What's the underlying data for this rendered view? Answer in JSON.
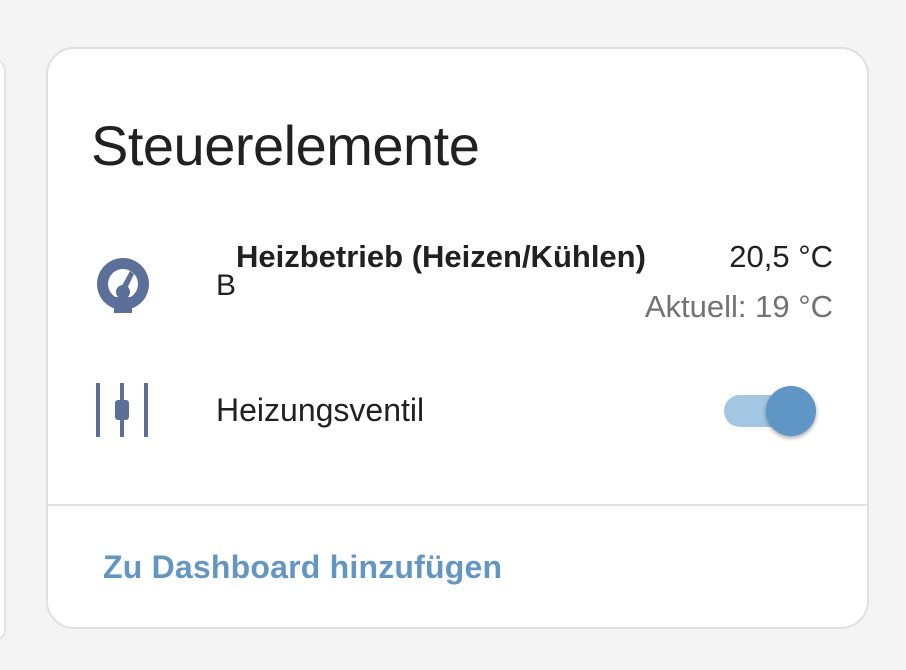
{
  "card": {
    "title": "Steuerelemente",
    "action_label": "Zu Dashboard hinzufügen"
  },
  "thermostat": {
    "icon": "thermostat-dial-icon",
    "name_prefix": "B",
    "name": "Heizbetrieb (Heizen/Kühlen)",
    "state": "20,5 °C",
    "secondary": "Aktuell: 19 °C"
  },
  "valve": {
    "icon": "valve-slider-icon",
    "name": "Heizungsventil",
    "toggle_on": true
  },
  "colors": {
    "icon": "#5b6f98",
    "accent": "#5f96c5",
    "accent_light": "#a3c6e3",
    "link": "#6396c2"
  }
}
